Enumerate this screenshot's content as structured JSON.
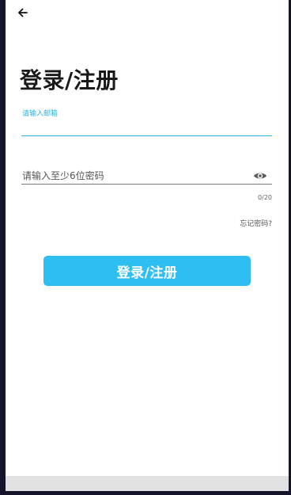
{
  "header": {
    "back_icon": "arrow-left-icon"
  },
  "page": {
    "title": "登录/注册"
  },
  "email": {
    "label": "请输入邮箱",
    "value": ""
  },
  "password": {
    "placeholder": "请输入至少6位密码",
    "counter": "0/20",
    "visibility_icon": "eye-icon"
  },
  "actions": {
    "forgot_label": "忘记密码?",
    "submit_label": "登录/注册"
  },
  "colors": {
    "accent": "#2fbef1",
    "focus_line": "#28b4e0",
    "frame_border": "#14142a"
  }
}
